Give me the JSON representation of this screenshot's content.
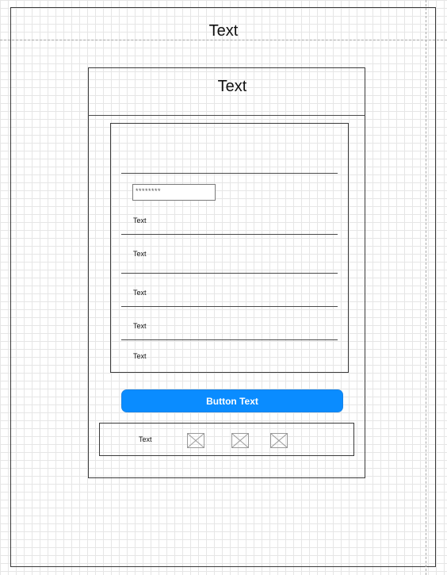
{
  "page": {
    "title": "Text"
  },
  "dialog": {
    "header_title": "Text",
    "password_placeholder": "********",
    "rows": [
      "Text",
      "Text",
      "Text",
      "Text",
      "Text"
    ],
    "button_label": "Button Text"
  },
  "footer": {
    "label": "Text",
    "icons": [
      "image-placeholder-icon",
      "image-placeholder-icon",
      "image-placeholder-icon"
    ]
  },
  "colors": {
    "button": "#0a8cff",
    "grid": "#e6e6e6",
    "stroke": "#3a3a3a"
  }
}
